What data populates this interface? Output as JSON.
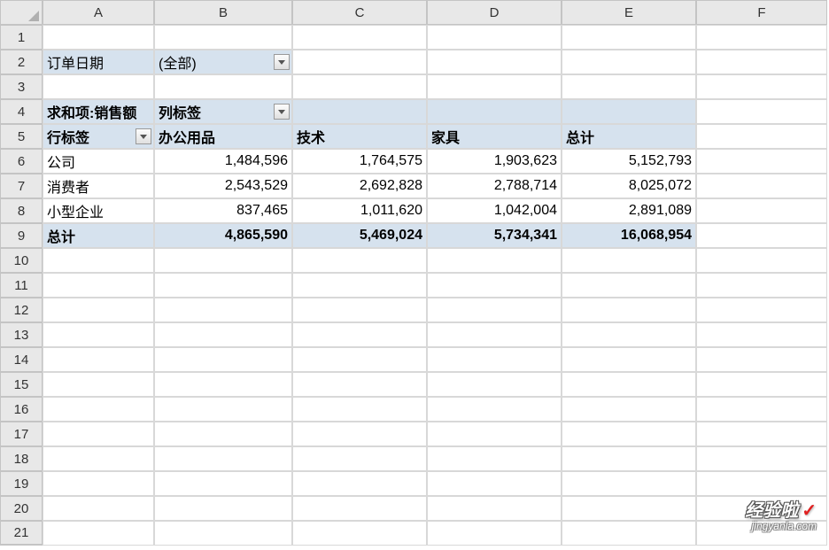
{
  "cols": [
    "A",
    "B",
    "C",
    "D",
    "E",
    "F"
  ],
  "rows_visible": 21,
  "filter_label": "订单日期",
  "filter_value": "(全部)",
  "measure_label": "求和项:销售额",
  "col_labels_label": "列标签",
  "row_labels_label": "行标签",
  "col_headers": [
    "办公用品",
    "技术",
    "家具",
    "总计"
  ],
  "data_rows": [
    {
      "label": "公司",
      "vals": [
        "1,484,596",
        "1,764,575",
        "1,903,623",
        "5,152,793"
      ]
    },
    {
      "label": "消费者",
      "vals": [
        "2,543,529",
        "2,692,828",
        "2,788,714",
        "8,025,072"
      ]
    },
    {
      "label": "小型企业",
      "vals": [
        "837,465",
        "1,011,620",
        "1,042,004",
        "2,891,089"
      ]
    }
  ],
  "total_label": "总计",
  "totals": [
    "4,865,590",
    "5,469,024",
    "5,734,341",
    "16,068,954"
  ],
  "watermark_title": "经验啦",
  "watermark_url": "jingyanla.com"
}
